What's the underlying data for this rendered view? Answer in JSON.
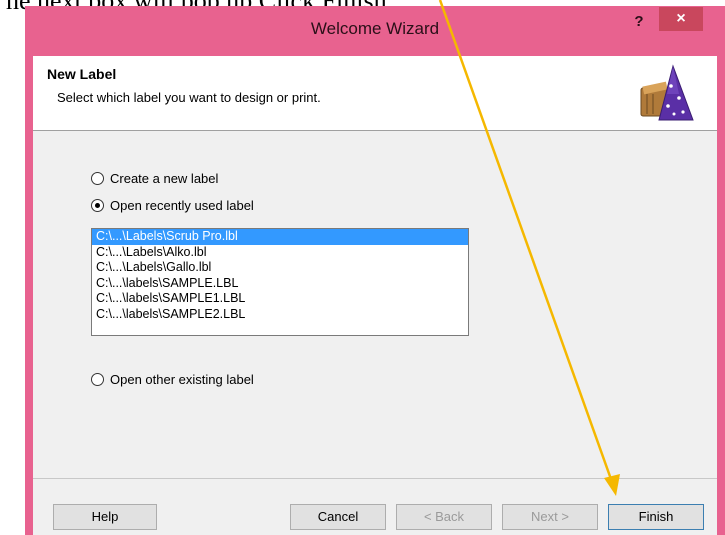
{
  "caption": "he next box will pop up  Click Finish",
  "window": {
    "title": "Welcome Wizard",
    "help_glyph": "?",
    "close_glyph": "×"
  },
  "header": {
    "title": "New Label",
    "subtitle": "Select which label you want to design or print."
  },
  "options": [
    {
      "label": "Create a new label",
      "checked": false
    },
    {
      "label": "Open recently used label",
      "checked": true
    },
    {
      "label": "Open other existing label",
      "checked": false
    }
  ],
  "recent_files": [
    {
      "path": "C:\\...\\Labels\\Scrub Pro.lbl",
      "selected": true
    },
    {
      "path": "C:\\...\\Labels\\Alko.lbl",
      "selected": false
    },
    {
      "path": "C:\\...\\Labels\\Gallo.lbl",
      "selected": false
    },
    {
      "path": "C:\\...\\labels\\SAMPLE.LBL",
      "selected": false
    },
    {
      "path": "C:\\...\\labels\\SAMPLE1.LBL",
      "selected": false
    },
    {
      "path": "C:\\...\\labels\\SAMPLE2.LBL",
      "selected": false
    }
  ],
  "buttons": {
    "help": "Help",
    "cancel": "Cancel",
    "back": "< Back",
    "next": "Next >",
    "finish": "Finish"
  },
  "colors": {
    "window_frame": "#e8628f",
    "close_button": "#c9475d",
    "selection": "#3399ff",
    "annotation_arrow": "#f5b800"
  }
}
